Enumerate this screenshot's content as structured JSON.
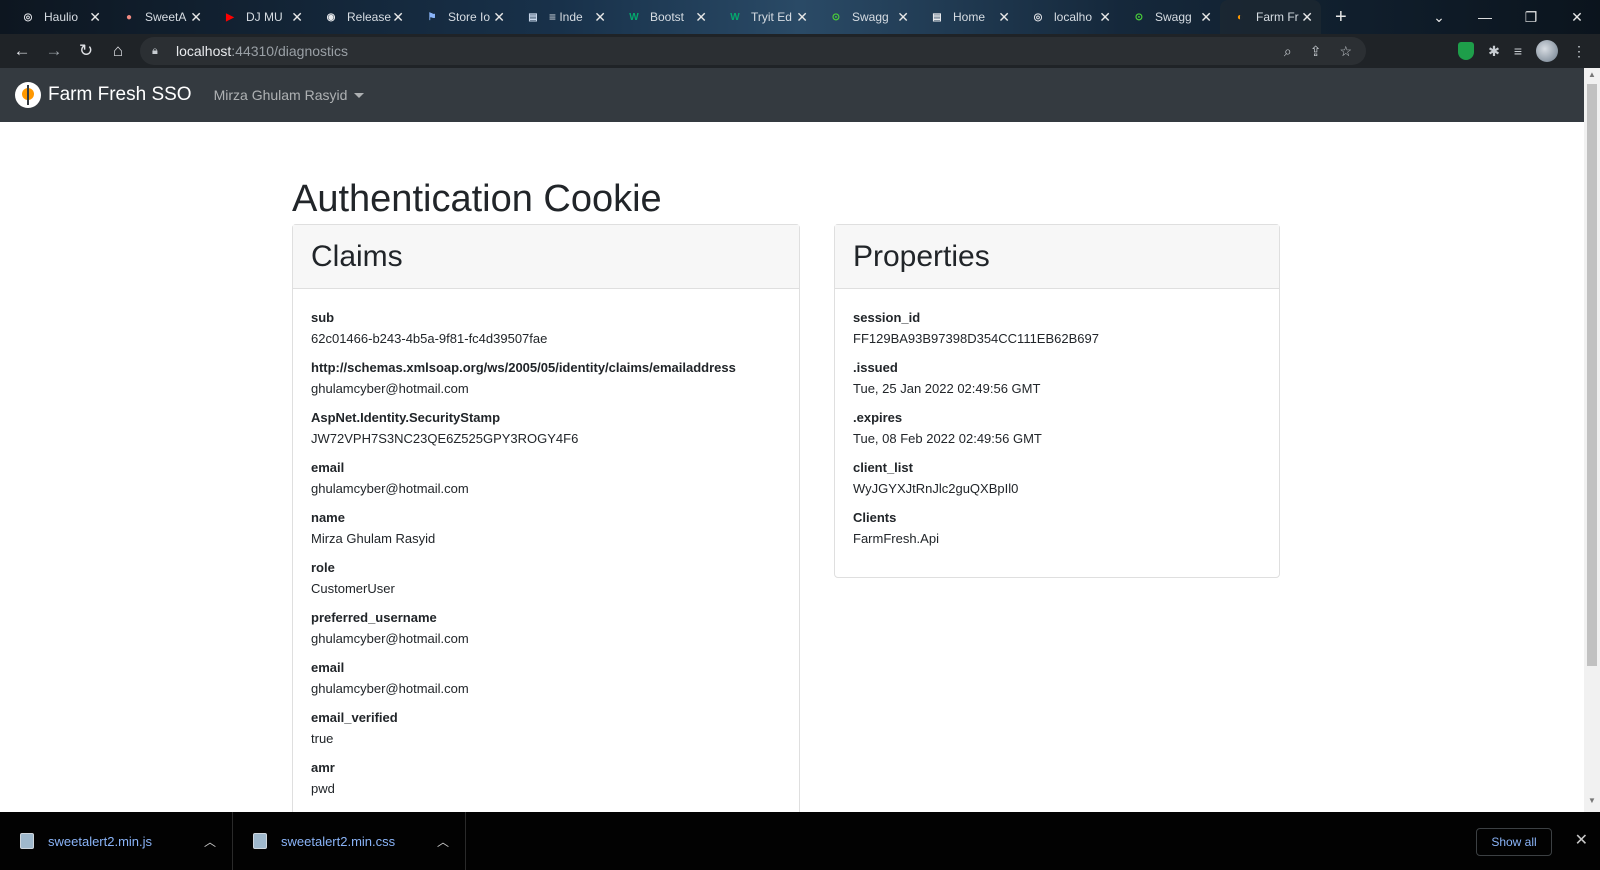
{
  "tabs": [
    {
      "title": "Haulio",
      "fav_color": "#dfe1e5",
      "fav_glyph": "◎"
    },
    {
      "title": "SweetA",
      "fav_color": "#f28b82",
      "fav_glyph": "●"
    },
    {
      "title": "DJ MU",
      "fav_color": "#ff0000",
      "fav_glyph": "▶"
    },
    {
      "title": "Release",
      "fav_color": "#e8eaed",
      "fav_glyph": "◉"
    },
    {
      "title": "Store Io",
      "fav_color": "#8ab4f8",
      "fav_glyph": "⚑"
    },
    {
      "title": "≡ Inde",
      "fav_color": "#c8d7ea",
      "fav_glyph": "▤"
    },
    {
      "title": "Bootst",
      "fav_color": "#04aa6d",
      "fav_glyph": "W"
    },
    {
      "title": "Tryit Ed",
      "fav_color": "#04aa6d",
      "fav_glyph": "W"
    },
    {
      "title": "Swagg",
      "fav_color": "#49cc3a",
      "fav_glyph": "⊙"
    },
    {
      "title": "Home",
      "fav_color": "#e8eaed",
      "fav_glyph": "▤"
    },
    {
      "title": "localho",
      "fav_color": "#dfe1e5",
      "fav_glyph": "◎"
    },
    {
      "title": "Swagg",
      "fav_color": "#49cc3a",
      "fav_glyph": "⊙"
    },
    {
      "title": "Farm Fr",
      "fav_color": "#ff9800",
      "fav_glyph": "◐"
    }
  ],
  "address": {
    "host": "localhost",
    "path": ":44310/diagnostics"
  },
  "navbar": {
    "brand": "Farm Fresh SSO",
    "user": "Mirza Ghulam Rasyid"
  },
  "page": {
    "title": "Authentication Cookie"
  },
  "claims": {
    "header": "Claims",
    "items": [
      {
        "key": "sub",
        "value": "62c01466-b243-4b5a-9f81-fc4d39507fae"
      },
      {
        "key": "http://schemas.xmlsoap.org/ws/2005/05/identity/claims/emailaddress",
        "value": "ghulamcyber@hotmail.com"
      },
      {
        "key": "AspNet.Identity.SecurityStamp",
        "value": "JW72VPH7S3NC23QE6Z525GPY3ROGY4F6"
      },
      {
        "key": "email",
        "value": "ghulamcyber@hotmail.com"
      },
      {
        "key": "name",
        "value": "Mirza Ghulam Rasyid"
      },
      {
        "key": "role",
        "value": "CustomerUser"
      },
      {
        "key": "preferred_username",
        "value": "ghulamcyber@hotmail.com"
      },
      {
        "key": "email",
        "value": "ghulamcyber@hotmail.com"
      },
      {
        "key": "email_verified",
        "value": "true"
      },
      {
        "key": "amr",
        "value": "pwd"
      }
    ]
  },
  "properties": {
    "header": "Properties",
    "items": [
      {
        "key": "session_id",
        "value": "FF129BA93B97398D354CC111EB62B697"
      },
      {
        "key": ".issued",
        "value": "Tue, 25 Jan 2022 02:49:56 GMT"
      },
      {
        "key": ".expires",
        "value": "Tue, 08 Feb 2022 02:49:56 GMT"
      },
      {
        "key": "client_list",
        "value": "WyJGYXJtRnJlc2guQXBpIl0"
      },
      {
        "key": "Clients",
        "value": "FarmFresh.Api"
      }
    ]
  },
  "downloads": {
    "files": [
      {
        "name": "sweetalert2.min.js"
      },
      {
        "name": "sweetalert2.min.css"
      }
    ],
    "show_all": "Show all"
  }
}
